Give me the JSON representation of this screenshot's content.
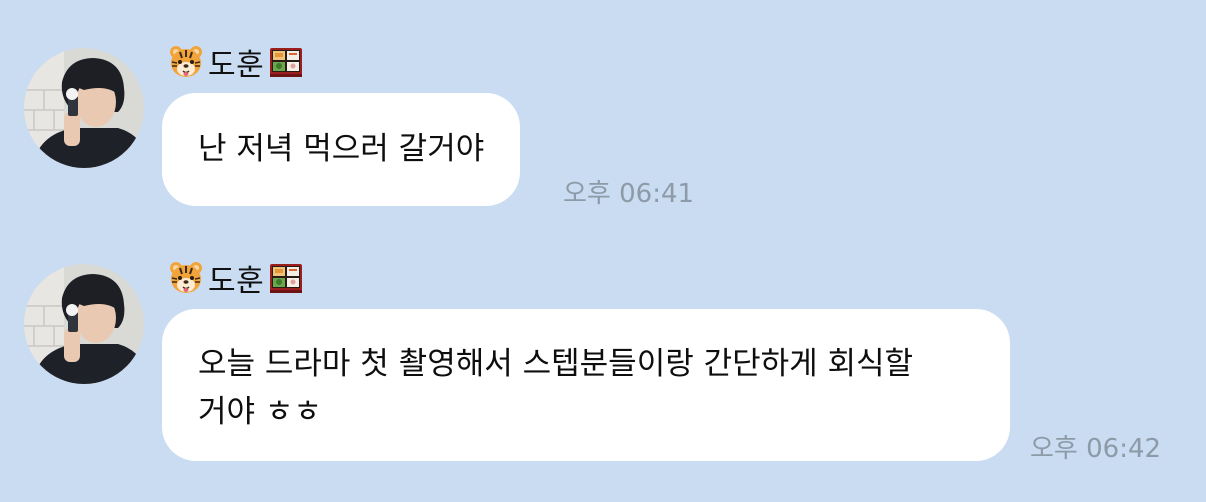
{
  "colors": {
    "background": "#c9dcf1",
    "bubble": "#ffffff",
    "time_text": "#8d9aa8"
  },
  "messages": [
    {
      "sender": "도훈",
      "sender_prefix_icon": "tiger-face-icon",
      "sender_suffix_icon": "bento-box-icon",
      "text": "난 저녁 먹으러 갈거야",
      "time": "오후 06:41"
    },
    {
      "sender": "도훈",
      "sender_prefix_icon": "tiger-face-icon",
      "sender_suffix_icon": "bento-box-icon",
      "text": "오늘 드라마 첫 촬영해서 스텝분들이랑 간단하게 회식할\n거야 ㅎㅎ",
      "time": "오후 06:42"
    }
  ]
}
